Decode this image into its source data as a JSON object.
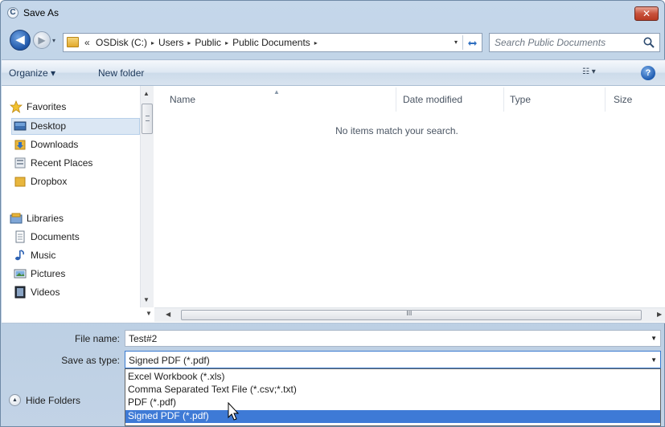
{
  "window": {
    "title": "Save As",
    "close_glyph": "✕",
    "title_icon": "C"
  },
  "address": {
    "overflow": "«",
    "crumbs": [
      "OSDisk (C:)",
      "Users",
      "Public",
      "Public Documents"
    ],
    "separator": "▸",
    "dropdown_glyph": "▾",
    "refresh_glyph": "⁴⁄₊"
  },
  "navigation": {
    "back_glyph": "◀",
    "forward_glyph": "▶",
    "history_glyph": "▾"
  },
  "search": {
    "placeholder": "Search Public Documents"
  },
  "toolbar": {
    "organize_label": "Organize ▾",
    "new_folder_label": "New folder",
    "views_label": "☷ ▾",
    "help_label": "?"
  },
  "sidebar": {
    "favorites_label": "Favorites",
    "favorites": [
      "Desktop",
      "Downloads",
      "Recent Places",
      "Dropbox"
    ],
    "libraries_label": "Libraries",
    "libraries": [
      "Documents",
      "Music",
      "Pictures",
      "Videos"
    ]
  },
  "file_list": {
    "columns": [
      "Name",
      "Date modified",
      "Type",
      "Size"
    ],
    "empty_message": "No items match your search.",
    "scroll_grip": "III"
  },
  "form": {
    "file_name_label": "File name:",
    "file_name_value": "Test#2",
    "save_type_label": "Save as type:",
    "save_type_value": "Signed PDF (*.pdf)",
    "type_options": [
      "Excel Workbook (*.xls)",
      "Comma Separated Text File (*.csv;*.txt)",
      "PDF (*.pdf)",
      "Signed PDF (*.pdf)"
    ],
    "hide_folders_label": "Hide Folders"
  },
  "colors": {
    "selection": "#3e7ad6",
    "window_chrome": "#c5d7ea",
    "accent": "#1f56a8"
  }
}
